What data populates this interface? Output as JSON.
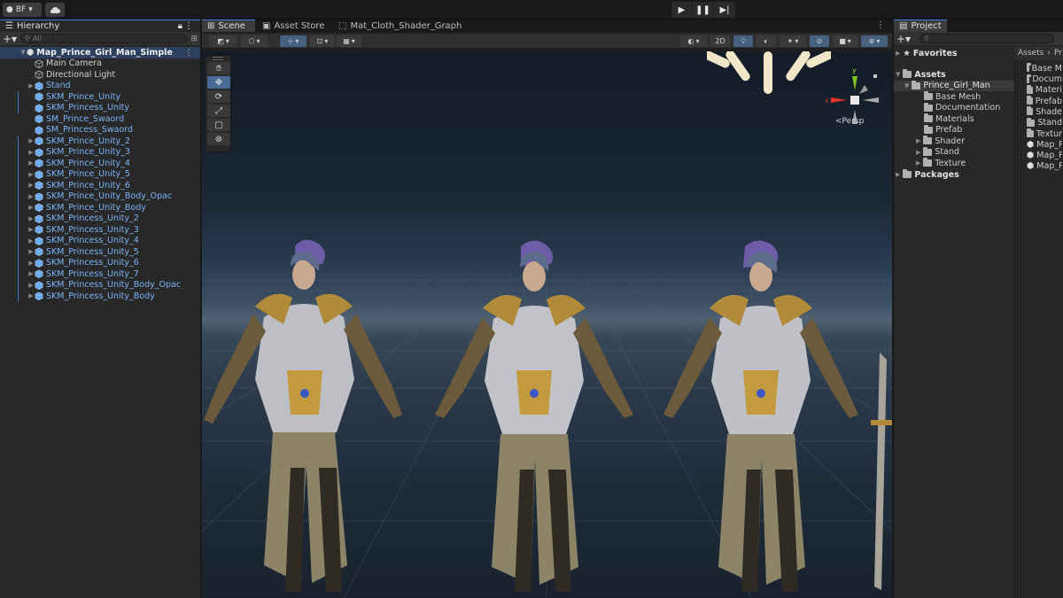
{
  "toolbar": {
    "account_label": "BF",
    "play_icons": [
      "play-icon",
      "pause-icon",
      "step-icon"
    ]
  },
  "hierarchy": {
    "tab_label": "Hierarchy",
    "search_placeholder": "All",
    "root": "Map_Prince_Girl_Man_Simple",
    "items": [
      {
        "label": "Main Camera",
        "color": "white",
        "arrow": false
      },
      {
        "label": "Directional Light",
        "color": "white",
        "arrow": false
      },
      {
        "label": "Stand",
        "color": "blue",
        "arrow": true
      },
      {
        "label": "SKM_Prince_Unity",
        "color": "blue",
        "arrow": false
      },
      {
        "label": "SKM_Princess_Unity",
        "color": "blue",
        "arrow": false
      },
      {
        "label": "SM_Prince_Swaord",
        "color": "blue",
        "arrow": false
      },
      {
        "label": "SM_Princess_Swaord",
        "color": "blue",
        "arrow": false
      },
      {
        "label": "SKM_Prince_Unity_2",
        "color": "blue",
        "arrow": true
      },
      {
        "label": "SKM_Prince_Unity_3",
        "color": "blue",
        "arrow": true
      },
      {
        "label": "SKM_Prince_Unity_4",
        "color": "blue",
        "arrow": true
      },
      {
        "label": "SKM_Prince_Unity_5",
        "color": "blue",
        "arrow": true
      },
      {
        "label": "SKM_Prince_Unity_6",
        "color": "blue",
        "arrow": true
      },
      {
        "label": "SKM_Prince_Unity_Body_Opac",
        "color": "blue",
        "arrow": true
      },
      {
        "label": "SKM_Prince_Unity_Body",
        "color": "blue",
        "arrow": true
      },
      {
        "label": "SKM_Princess_Unity_2",
        "color": "blue",
        "arrow": true
      },
      {
        "label": "SKM_Princess_Unity_3",
        "color": "blue",
        "arrow": true
      },
      {
        "label": "SKM_Princess_Unity_4",
        "color": "blue",
        "arrow": true
      },
      {
        "label": "SKM_Princess_Unity_5",
        "color": "blue",
        "arrow": true
      },
      {
        "label": "SKM_Princess_Unity_6",
        "color": "blue",
        "arrow": true
      },
      {
        "label": "SKM_Princess_Unity_7",
        "color": "blue",
        "arrow": true
      },
      {
        "label": "SKM_Princess_Unity_Body_Opac",
        "color": "blue",
        "arrow": true
      },
      {
        "label": "SKM_Princess_Unity_Body",
        "color": "blue",
        "arrow": true
      }
    ]
  },
  "scene": {
    "tabs": [
      "Scene",
      "Asset Store",
      "Mat_Cloth_Shader_Graph"
    ],
    "toggle_2d": "2D",
    "persp_label": "Persp",
    "gizmo_axes": {
      "y": "y",
      "x": "x"
    }
  },
  "project": {
    "tab_label": "Project",
    "favorites": "Favorites",
    "assets": "Assets",
    "selected_folder": "Prince_Girl_Man",
    "subfolders": [
      "Base Mesh",
      "Documentation",
      "Materials",
      "Prefab"
    ],
    "collapsed_folders": [
      "Shader",
      "Stand",
      "Texture"
    ],
    "packages": "Packages",
    "breadcrumb": [
      "Assets",
      "Pr"
    ],
    "right_items": [
      {
        "label": "Base M",
        "type": "folder"
      },
      {
        "label": "Docum",
        "type": "folder"
      },
      {
        "label": "Materi",
        "type": "folder"
      },
      {
        "label": "Prefab",
        "type": "folder"
      },
      {
        "label": "Shade",
        "type": "folder"
      },
      {
        "label": "Stand",
        "type": "folder"
      },
      {
        "label": "Textur",
        "type": "folder"
      },
      {
        "label": "Map_P",
        "type": "scene"
      },
      {
        "label": "Map_P",
        "type": "scene"
      },
      {
        "label": "Map_P",
        "type": "scene"
      }
    ]
  },
  "colors": {
    "selection_blue": "#4c7fd8",
    "prefab_blue": "#7ab4f7",
    "gizmo_x": "#e0352b",
    "gizmo_y": "#7ec426"
  }
}
